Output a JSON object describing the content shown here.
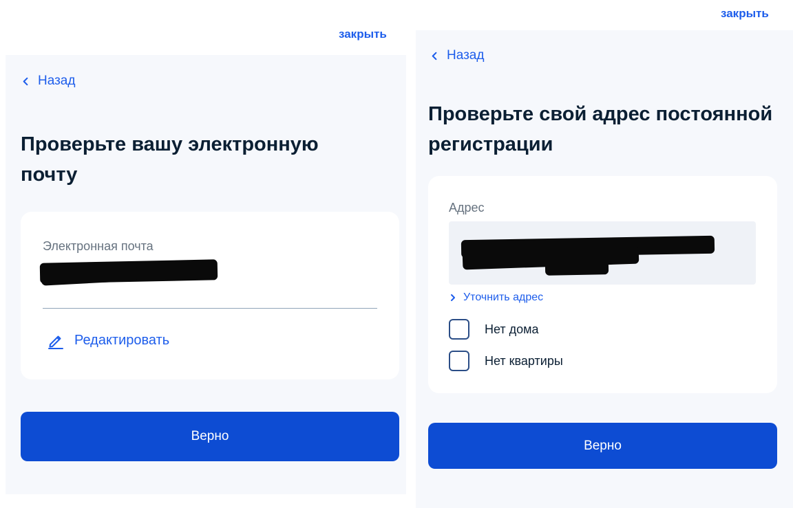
{
  "colors": {
    "accent": "#1d5deb",
    "primary_button": "#0d4cd3",
    "text": "#0b1f33",
    "muted": "#66727f",
    "screen_bg": "#f6f8fc",
    "card_bg": "#ffffff"
  },
  "left_screen": {
    "close_label": "закрыть",
    "back_label": "Назад",
    "back_icon": "chevron-left-icon",
    "title": "Проверьте вашу электронную почту",
    "email_label": "Электронная почта",
    "edit_label": "Редактировать",
    "edit_icon": "pencil-icon",
    "confirm_label": "Верно"
  },
  "right_screen": {
    "close_label": "закрыть",
    "back_label": "Назад",
    "back_icon": "chevron-left-icon",
    "title": "Проверьте свой адрес постоянной регистрации",
    "address_label": "Адрес",
    "refine_label": "Уточнить адрес",
    "refine_icon": "chevron-right-icon",
    "checkboxes": [
      {
        "label": "Нет дома",
        "checked": false
      },
      {
        "label": "Нет квартиры",
        "checked": false
      }
    ],
    "confirm_label": "Верно"
  }
}
